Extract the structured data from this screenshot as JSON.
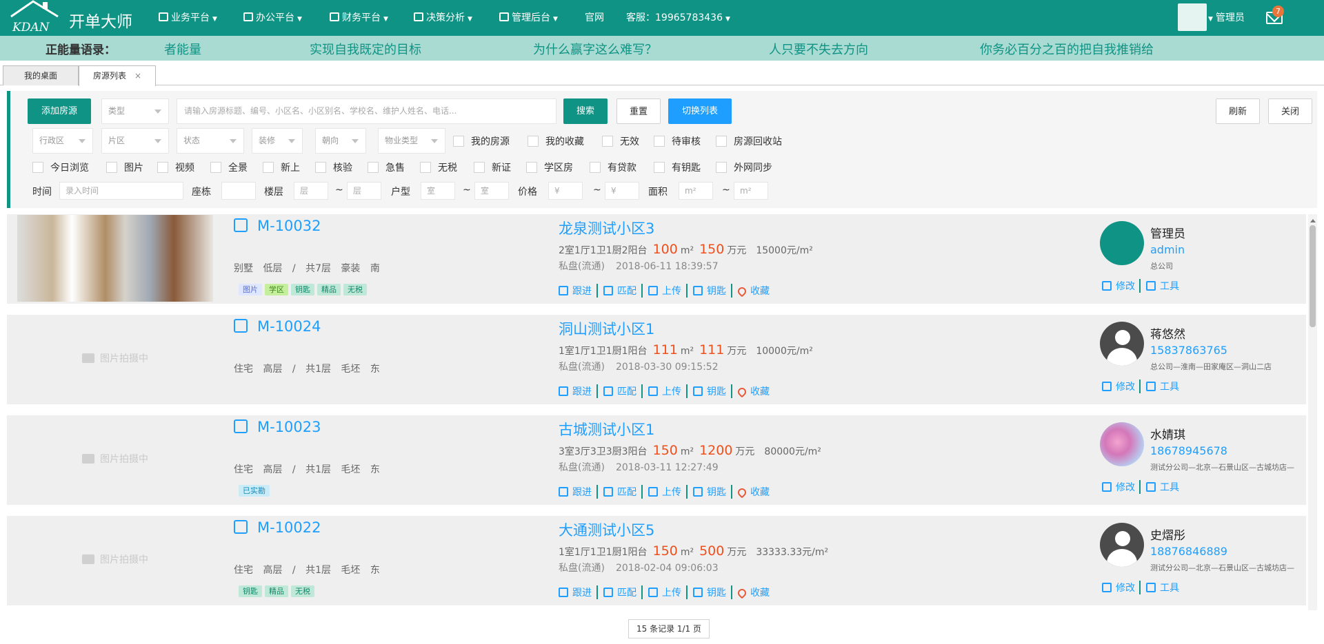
{
  "header": {
    "logo_text": "KDAN",
    "app_name": "开单大师",
    "nav": [
      {
        "label": "业务平台",
        "icon": "grid-icon"
      },
      {
        "label": "办公平台",
        "icon": "briefcase-icon"
      },
      {
        "label": "财务平台",
        "icon": "yen-icon"
      },
      {
        "label": "决策分析",
        "icon": "chart-icon"
      },
      {
        "label": "管理后台",
        "icon": "dashboard-icon"
      },
      {
        "label": "官网",
        "icon": ""
      },
      {
        "label": "客服：19965783436",
        "icon": ""
      }
    ],
    "user": "管理员",
    "unread_count": "7"
  },
  "slogan": {
    "label": "正能量语录：",
    "items": [
      "者能量",
      "实现自我既定的目标",
      "为什么赢字这么难写？",
      "人只要不失去方向",
      "你务必百分之百的把自我推销给"
    ]
  },
  "tabs": [
    {
      "label": "我的桌面"
    },
    {
      "label": "房源列表",
      "close": "×"
    }
  ],
  "filter": {
    "add_button": "添加房源",
    "type_select": "类型",
    "search_placeholder": "请输入房源标题、编号、小区名、小区别名、学校名、维护人姓名、电话...",
    "search_button": "搜索",
    "reset_button": "重置",
    "switch_button": "切换列表",
    "refresh_button": "刷新",
    "close_button": "关闭",
    "selects": [
      "行政区",
      "片区",
      "状态",
      "装修",
      "朝向",
      "物业类型"
    ],
    "checks_row1": [
      "我的房源",
      "我的收藏",
      "无效",
      "待审核",
      "房源回收站"
    ],
    "checks_row2": [
      "今日浏览",
      "图片",
      "视频",
      "全景",
      "新上",
      "核验",
      "急售",
      "无税",
      "新证",
      "学区房",
      "有贷款",
      "有钥匙",
      "外网同步"
    ],
    "time_label": "时间",
    "time_placeholder": "录入时间",
    "building_label": "座栋",
    "floor_label": "楼层",
    "floor_ph": "层",
    "tilde": "~",
    "layout_label": "户型",
    "room_ph": "室",
    "price_label": "价格",
    "price_ph": "¥",
    "area_label": "面积",
    "area_ph": "m²"
  },
  "listings": [
    {
      "code": "M-10032",
      "has_photo": true,
      "photo_text": "",
      "spec": "别墅 低层 / 共7层 豪装 南",
      "tags": [
        {
          "label": "图片",
          "bg": "#dfe6ff",
          "fg": "#5b6fd6"
        },
        {
          "label": "学区",
          "bg": "#c6ef9d",
          "fg": "#3d8a1a"
        },
        {
          "label": "钥匙",
          "bg": "#bfe8d8",
          "fg": "#0f8a6a"
        },
        {
          "label": "精品",
          "bg": "#bfe8d8",
          "fg": "#0f8a6a"
        },
        {
          "label": "无税",
          "bg": "#bfe8d8",
          "fg": "#0f8a6a"
        }
      ],
      "title": "龙泉测试小区3",
      "layout": "2室1厅1卫1厨2阳台",
      "area": "100",
      "area_unit": "m²",
      "price": "150",
      "price_unit": "万元",
      "unit_price": "15000元/m²",
      "status": "私盘(流通)",
      "date": "2018-06-11 18:39:57",
      "agent": {
        "name": "管理员",
        "phone": "admin",
        "org": "总公司",
        "avatar": "logo"
      }
    },
    {
      "code": "M-10024",
      "has_photo": false,
      "photo_text": "图片拍摄中",
      "spec": "住宅 高层 / 共1层 毛坯 东",
      "tags": [],
      "title": "洞山测试小区1",
      "layout": "1室1厅1卫1厨1阳台",
      "area": "111",
      "area_unit": "m²",
      "price": "111",
      "price_unit": "万元",
      "unit_price": "10000元/m²",
      "status": "私盘(流通)",
      "date": "2018-03-30 09:15:52",
      "agent": {
        "name": "蒋悠然",
        "phone": "15837863765",
        "org": "总公司—淮南—田家庵区—洞山二店",
        "avatar": "gray"
      }
    },
    {
      "code": "M-10023",
      "has_photo": false,
      "photo_text": "图片拍摄中",
      "spec": "住宅 高层 / 共1层 毛坯 东",
      "tags": [
        {
          "label": "已实勘",
          "bg": "#c9ecf7",
          "fg": "#1b89b8"
        }
      ],
      "title": "古城测试小区1",
      "layout": "3室3厅3卫3厨3阳台",
      "area": "150",
      "area_unit": "m²",
      "price": "1200",
      "price_unit": "万元",
      "unit_price": "80000元/m²",
      "status": "私盘(流通)",
      "date": "2018-03-11 12:27:49",
      "agent": {
        "name": "水婧琪",
        "phone": "18678945678",
        "org": "测试分公司—北京—石景山区—古城坊店—",
        "avatar": "flower"
      }
    },
    {
      "code": "M-10022",
      "has_photo": false,
      "photo_text": "图片拍摄中",
      "spec": "住宅 高层 / 共1层 毛坯 东",
      "tags": [
        {
          "label": "钥匙",
          "bg": "#bfe8d8",
          "fg": "#0f8a6a"
        },
        {
          "label": "精品",
          "bg": "#bfe8d8",
          "fg": "#0f8a6a"
        },
        {
          "label": "无税",
          "bg": "#bfe8d8",
          "fg": "#0f8a6a"
        }
      ],
      "title": "大通测试小区5",
      "layout": "1室1厅1卫1厨1阳台",
      "area": "150",
      "area_unit": "m²",
      "price": "500",
      "price_unit": "万元",
      "unit_price": "33333.33元/m²",
      "status": "私盘(流通)",
      "date": "2018-02-04 09:06:03",
      "agent": {
        "name": "史熠彤",
        "phone": "18876846889",
        "org": "测试分公司—北京—石景山区—古城坊店—",
        "avatar": "gray"
      }
    }
  ],
  "row_actions": [
    "跟进",
    "匹配",
    "上传",
    "钥匙",
    "收藏"
  ],
  "agent_actions": [
    "修改",
    "工具"
  ],
  "pager": "15 条记录 1/1 页",
  "colors": {
    "brand": "#0f9384",
    "link": "#1e9fff",
    "price": "#ef4f1b"
  }
}
